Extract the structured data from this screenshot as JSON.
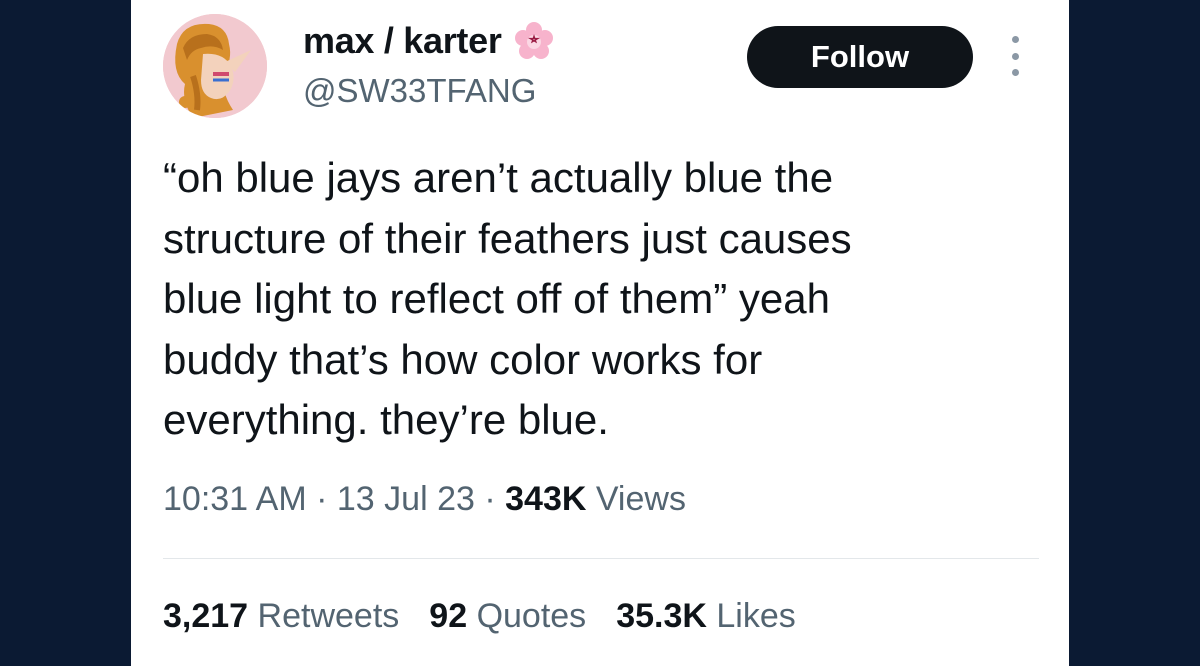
{
  "author": {
    "display_name": "max / karter",
    "handle": "@SW33TFANG",
    "badge_icon": "pink-flower-pentagram-icon",
    "avatar": "illustrated-avatar-orange-hair"
  },
  "follow_button": {
    "label": "Follow"
  },
  "more_button": {
    "icon": "more-vertical-icon"
  },
  "tweet": {
    "text": "“oh blue jays aren’t actually blue the\nstructure of their feathers just causes\nblue light to reflect off of them” yeah\nbuddy that’s how color works for\neverything. they’re blue."
  },
  "meta": {
    "time": "10:31 AM",
    "separator": "·",
    "date": "13 Jul 23",
    "views_count": "343K",
    "views_label": "Views"
  },
  "stats": {
    "retweets_count": "3,217",
    "retweets_label": "Retweets",
    "quotes_count": "92",
    "quotes_label": "Quotes",
    "likes_count": "35.3K",
    "likes_label": "Likes"
  },
  "colors": {
    "background": "#0b1a33",
    "card": "#ffffff",
    "text_primary": "#0f1419",
    "text_secondary": "#536471",
    "button": "#0f1419"
  }
}
